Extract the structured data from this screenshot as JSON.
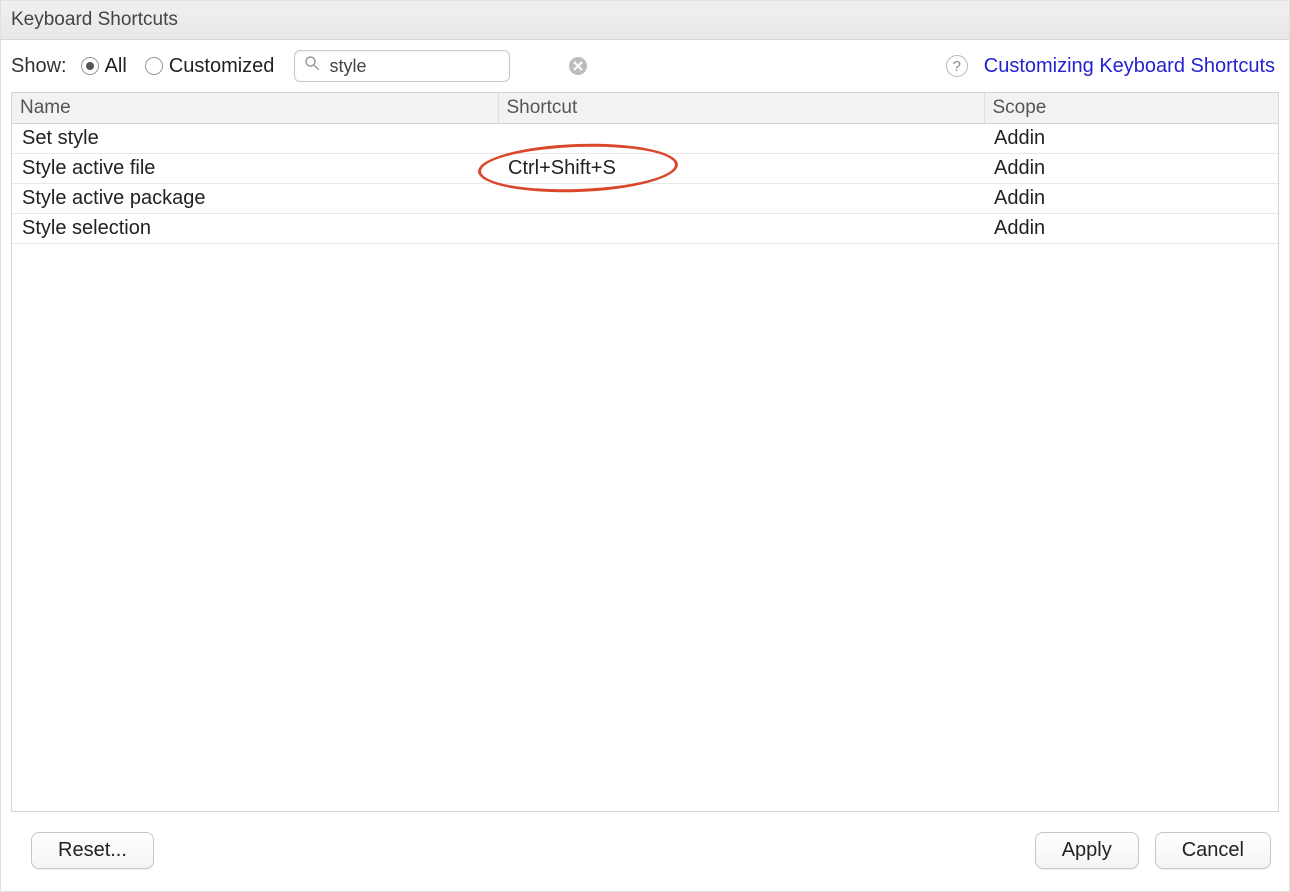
{
  "window": {
    "title": "Keyboard Shortcuts"
  },
  "toolbar": {
    "show_label": "Show:",
    "radio_all": "All",
    "radio_customized": "Customized",
    "search_value": "style",
    "help_link": "Customizing Keyboard Shortcuts"
  },
  "table": {
    "headers": {
      "name": "Name",
      "shortcut": "Shortcut",
      "scope": "Scope"
    },
    "rows": [
      {
        "name": "Set style",
        "shortcut": "",
        "scope": "Addin"
      },
      {
        "name": "Style active file",
        "shortcut": "Ctrl+Shift+S",
        "scope": "Addin"
      },
      {
        "name": "Style active package",
        "shortcut": "",
        "scope": "Addin"
      },
      {
        "name": "Style selection",
        "shortcut": "",
        "scope": "Addin"
      }
    ]
  },
  "footer": {
    "reset": "Reset...",
    "apply": "Apply",
    "cancel": "Cancel"
  },
  "annotation": {
    "highlight_row_index": 1
  }
}
